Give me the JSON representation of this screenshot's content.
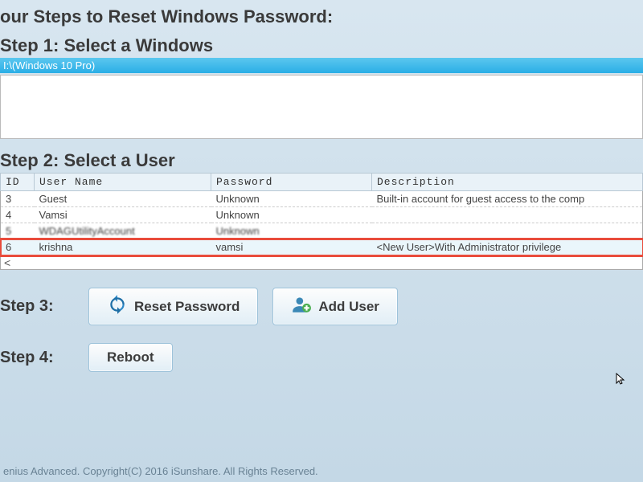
{
  "main_title": "our Steps to Reset Windows Password:",
  "step1": {
    "title": "Step 1: Select a Windows",
    "selected": "I:\\(Windows 10 Pro)"
  },
  "step2": {
    "title": "Step 2: Select a User",
    "headers": {
      "id": "ID",
      "user": "User Name",
      "password": "Password",
      "description": "Description"
    },
    "rows": [
      {
        "id": "3",
        "user": "Guest",
        "password": "Unknown",
        "description": "Built-in account for guest access to the comp"
      },
      {
        "id": "4",
        "user": "Vamsi",
        "password": "Unknown",
        "description": ""
      },
      {
        "id": "5",
        "user": "WDAGUtilityAccount",
        "password": "Unknown",
        "description": ""
      },
      {
        "id": "6",
        "user": "krishna",
        "password": "vamsi",
        "description": "<New User>With Administrator privilege"
      }
    ],
    "scroll_hint": "<"
  },
  "step3": {
    "label": "Step 3:",
    "reset_btn": "Reset Password",
    "add_btn": "Add User"
  },
  "step4": {
    "label": "Step 4:",
    "reboot_btn": "Reboot"
  },
  "footer": "enius Advanced. Copyright(C) 2016 iSunshare. All Rights Reserved."
}
